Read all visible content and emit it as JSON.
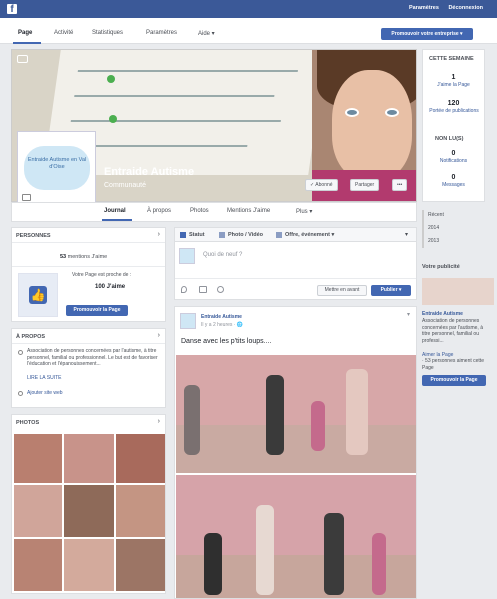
{
  "topbar": {
    "logo": "f",
    "links": [
      "Paramètres",
      "Déconnexion"
    ]
  },
  "tabs": [
    "Page",
    "Activité",
    "Statistiques",
    "Paramètres",
    "Aide ▾"
  ],
  "promote_top": "Promouvoir votre entreprise ▾",
  "page": {
    "title": "Entraide Autisme",
    "category": "Communauté",
    "logo_text": "Entraide Autisme en Val d'Oise"
  },
  "cover_buttons": [
    "✓ Abonné",
    "Partager",
    "•••"
  ],
  "nav_tabs": [
    "Journal",
    "À propos",
    "Photos",
    "Mentions J'aime",
    "Plus ▾"
  ],
  "week": {
    "title": "CETTE SEMAINE",
    "stats": [
      {
        "value": "1",
        "label": "J'aime la Page"
      },
      {
        "value": "120",
        "label": "Portée de publications"
      }
    ],
    "unread_title": "NON LU(S)",
    "unread": [
      {
        "value": "0",
        "label": "Notifications"
      },
      {
        "value": "0",
        "label": "Messages"
      }
    ]
  },
  "years": [
    "Récent",
    "2014",
    "2013"
  ],
  "ad": {
    "title": "Votre publicité",
    "page_name": "Entraide Autisme",
    "desc": "Association de personnes concernées par l'autisme, à titre personnel, familial ou professi...",
    "like": "Aimer la Page",
    "like_meta": "· 53 personnes aiment cette Page",
    "button": "Promouvoir la Page"
  },
  "people": {
    "title": "PERSONNES",
    "likes_count": "53",
    "likes_label": "mentions J'aime",
    "close_label": "Votre Page est proche de :",
    "goal": "100 J'aime",
    "button": "Promouvoir la Page"
  },
  "about": {
    "title": "À PROPOS",
    "desc": "Association de personnes concernées par l'autisme, à titre personnel, familial ou professionnel. Le but est de favoriser l'éducation et l'épanouissement...",
    "more": "LIRE LA SUITE",
    "website": "Ajouter site web"
  },
  "photos": {
    "title": "PHOTOS"
  },
  "composer": {
    "tabs": [
      "Statut",
      "Photo / Vidéo",
      "Offre, événement ▾"
    ],
    "placeholder": "Quoi de neuf ?",
    "boost": "Mettre en avant",
    "publish": "Publier ▾"
  },
  "post": {
    "author": "Entraide Autisme",
    "time": "Il y a 2 heures · 🌐",
    "text": "Danse avec les p'tits loups...."
  }
}
